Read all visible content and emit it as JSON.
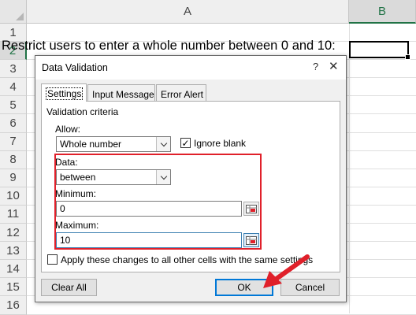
{
  "sheet": {
    "columns": [
      "A",
      "B"
    ],
    "rows": [
      "1",
      "2",
      "3",
      "4",
      "5",
      "6",
      "7",
      "8",
      "9",
      "10",
      "11",
      "12",
      "13",
      "14",
      "15",
      "16"
    ],
    "a2": "Restrict users to enter a whole number between 0 and 10:"
  },
  "dialog": {
    "title": "Data Validation",
    "help": "?",
    "close": "✕",
    "tabs": [
      "Settings",
      "Input Message",
      "Error Alert"
    ],
    "criteria_label": "Validation criteria",
    "allow_label": "Allow:",
    "allow_value": "Whole number",
    "ignore_blank_label": "Ignore blank",
    "ignore_blank_checked": true,
    "data_label": "Data:",
    "data_value": "between",
    "minimum_label": "Minimum:",
    "minimum_value": "0",
    "maximum_label": "Maximum:",
    "maximum_value": "10",
    "apply_label": "Apply these changes to all other cells with the same settings",
    "apply_checked": false,
    "clear_all": "Clear All",
    "ok": "OK",
    "cancel": "Cancel"
  },
  "colors": {
    "highlight": "#e0202a",
    "arrow": "#e0202a",
    "excel_green": "#217346"
  },
  "icons": [
    "range-select-icon",
    "dropdown-arrow-icon",
    "checkmark-icon",
    "close-icon",
    "red-arrow-icon"
  ]
}
